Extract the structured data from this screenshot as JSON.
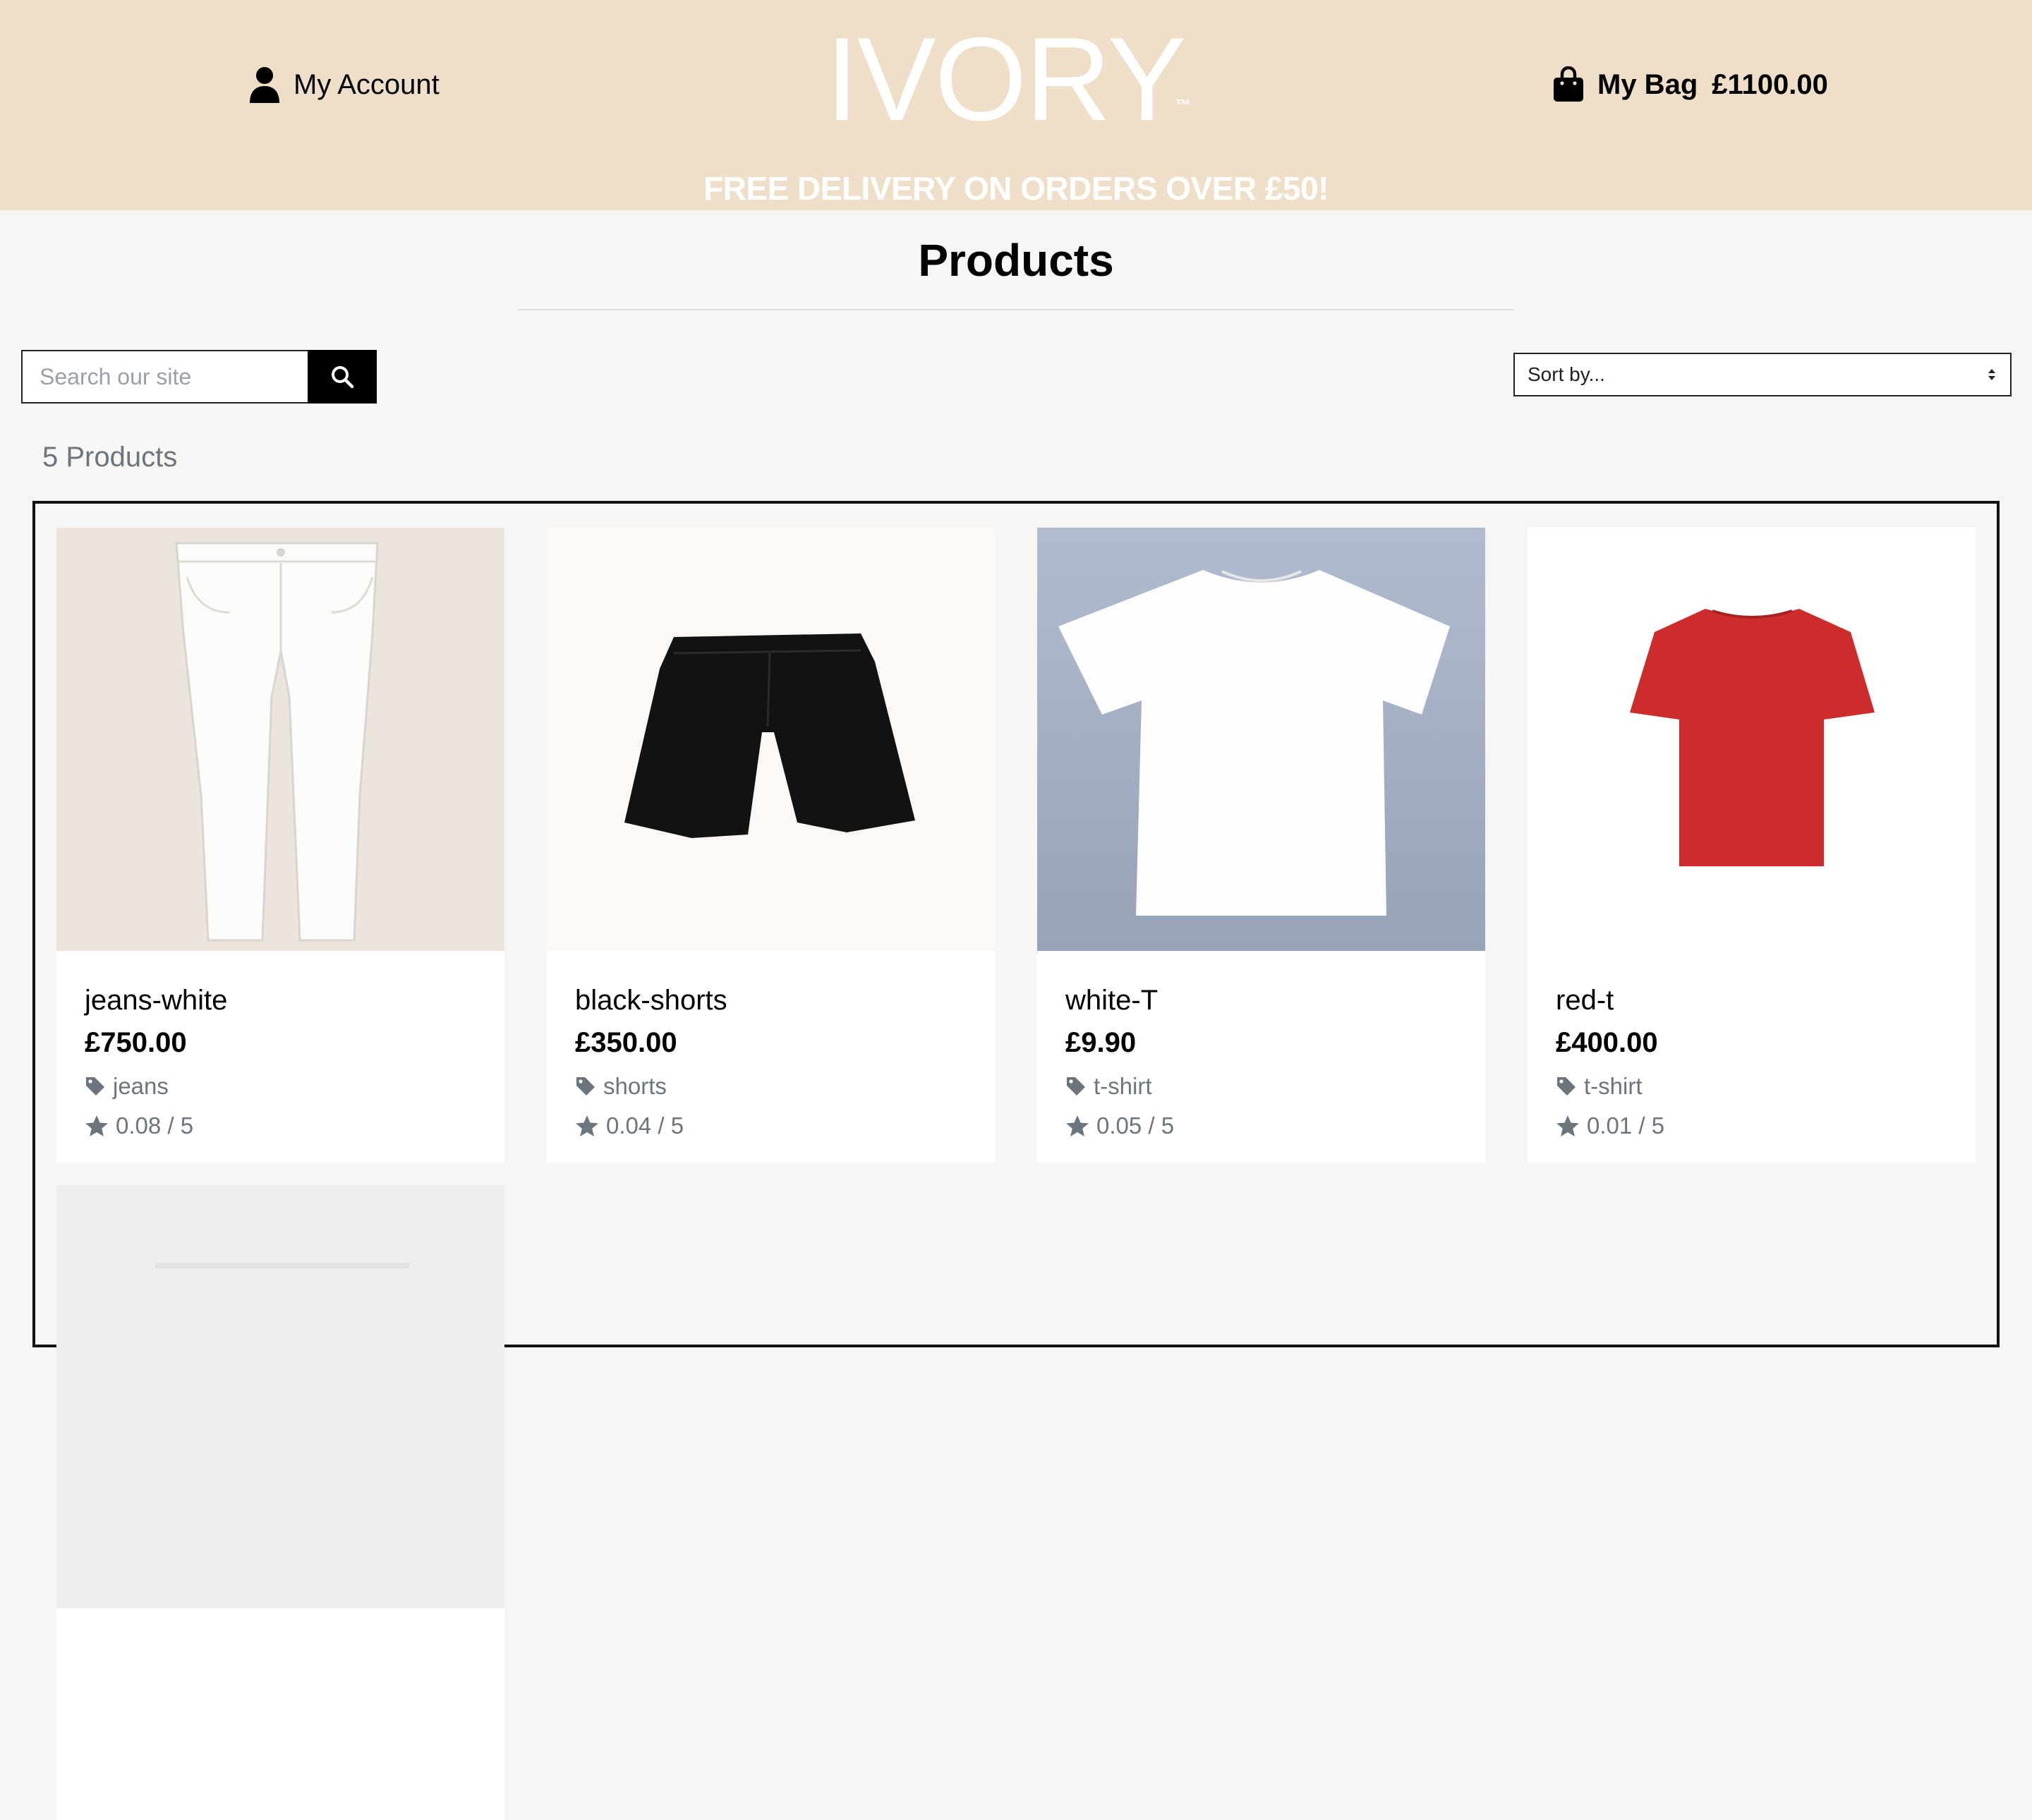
{
  "header": {
    "account_label": "My Account",
    "logo_text": "IVORY",
    "logo_tm": "™",
    "bag_label": "My Bag",
    "bag_total": "£1100.00",
    "delivery_banner": "FREE DELIVERY ON ORDERS OVER £50!"
  },
  "page": {
    "title": "Products",
    "search_placeholder": "Search our site",
    "sort_label": "Sort by...",
    "product_count": "5 Products"
  },
  "products": [
    {
      "name": "jeans-white",
      "price": "£750.00",
      "category": "jeans",
      "rating": "0.08 / 5",
      "image": "white-jeans"
    },
    {
      "name": "black-shorts",
      "price": "£350.00",
      "category": "shorts",
      "rating": "0.04 / 5",
      "image": "black-shorts"
    },
    {
      "name": "white-T",
      "price": "£9.90",
      "category": "t-shirt",
      "rating": "0.05 / 5",
      "image": "white-tshirt"
    },
    {
      "name": "red-t",
      "price": "£400.00",
      "category": "t-shirt",
      "rating": "0.01 / 5",
      "image": "red-tshirt"
    }
  ],
  "colors": {
    "header_bg": "#efdfc8",
    "page_bg": "#f7f6f4",
    "muted_text": "#6c757d",
    "red_tshirt": "#cc2d2c"
  }
}
